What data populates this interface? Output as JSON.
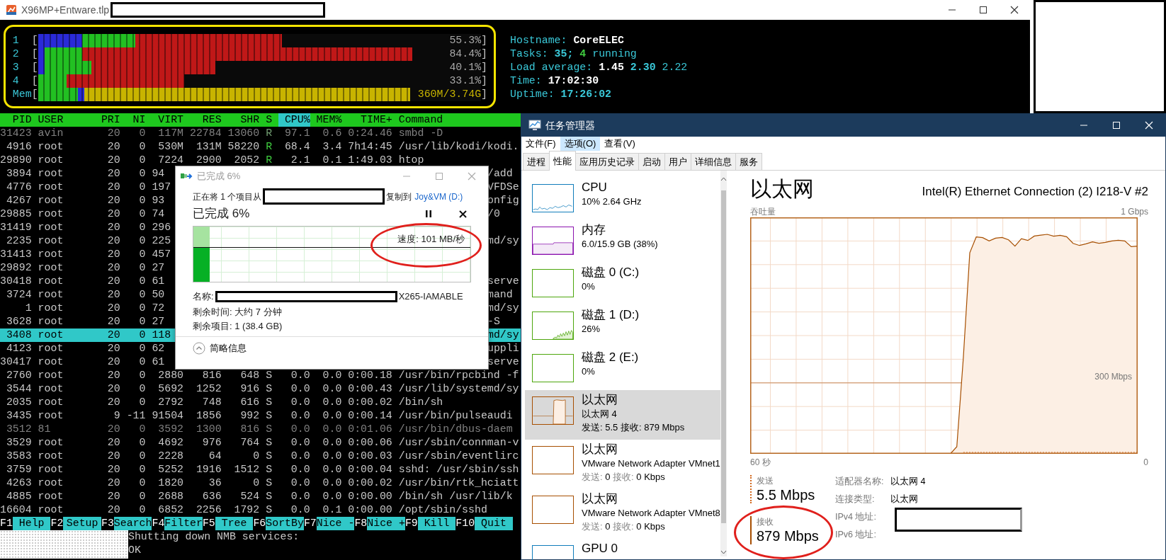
{
  "terminal": {
    "title": "X96MP+Entware.tlp",
    "meters": [
      {
        "kind": "cpu",
        "label": "1",
        "open": "[",
        "reading": "55.3%",
        "close": "]",
        "segments": [
          {
            "color": "#2a2ad8",
            "level": 0.1
          },
          {
            "color": "#22c022",
            "level": 0.22
          },
          {
            "color": "#c01818",
            "level": 0.55
          }
        ]
      },
      {
        "kind": "cpu",
        "label": "2",
        "open": "[",
        "reading": "84.4%",
        "close": "]",
        "segments": [
          {
            "color": "#2a2ad8",
            "level": 0.015
          },
          {
            "color": "#22c022",
            "level": 0.1
          },
          {
            "color": "#c01818",
            "level": 0.845
          }
        ]
      },
      {
        "kind": "cpu",
        "label": "3",
        "open": "[",
        "reading": "40.1%",
        "close": "]",
        "segments": [
          {
            "color": "#2a2ad8",
            "level": 0.015
          },
          {
            "color": "#22c022",
            "level": 0.12
          },
          {
            "color": "#c01818",
            "level": 0.4
          }
        ]
      },
      {
        "kind": "cpu",
        "label": "4",
        "open": "[",
        "reading": "33.1%",
        "close": "]",
        "segments": [
          {
            "color": "#22c022",
            "level": 0.065
          },
          {
            "color": "#c01818",
            "level": 0.33
          }
        ]
      },
      {
        "kind": "memory",
        "label": "Mem",
        "open": "[",
        "reading": "360M/3.74G",
        "close": "]",
        "segments": [
          {
            "color": "#22c022",
            "level": 0.09
          },
          {
            "color": "#2a2ad8",
            "level": 0.105
          },
          {
            "color": "#c8b400",
            "level": 0.84
          }
        ]
      }
    ],
    "info": [
      {
        "parts": [
          {
            "text": "Hostname:",
            "kind": "label"
          },
          {
            "text": "CoreELEC",
            "kind": "value"
          }
        ]
      },
      {
        "parts": [
          {
            "text": "Tasks:",
            "kind": "label"
          },
          {
            "text": "35;",
            "kind": "accent"
          },
          {
            "text": "4",
            "kind": "running"
          },
          {
            "text": "running",
            "kind": "label"
          }
        ]
      },
      {
        "parts": [
          {
            "text": "Load average:",
            "kind": "label"
          },
          {
            "text": "1.45",
            "kind": "value"
          },
          {
            "text": "2.30",
            "kind": "accent"
          },
          {
            "text": "2.22",
            "kind": "label"
          }
        ]
      },
      {
        "parts": [
          {
            "text": "Time:",
            "kind": "label"
          },
          {
            "text": "17:02:30",
            "kind": "value"
          }
        ]
      },
      {
        "parts": [
          {
            "text": "Uptime:",
            "kind": "label"
          },
          {
            "text": "17:26:02",
            "kind": "accent"
          }
        ]
      }
    ],
    "columns": [
      {
        "label": "PID",
        "selected": false
      },
      {
        "label": "USER",
        "selected": false
      },
      {
        "label": "PRI",
        "selected": false
      },
      {
        "label": "NI",
        "selected": false
      },
      {
        "label": "VIRT",
        "selected": false
      },
      {
        "label": "RES",
        "selected": false
      },
      {
        "label": "SHR",
        "selected": false
      },
      {
        "label": "S",
        "selected": false
      },
      {
        "label": "CPU%",
        "selected": true
      },
      {
        "label": "MEM%",
        "selected": false
      },
      {
        "label": "TIME+",
        "selected": false
      },
      {
        "label": "Command",
        "selected": false
      }
    ],
    "processes": [
      {
        "pid": "31423",
        "user": "avin",
        "pri": "20",
        "ni": "0",
        "virt": "117M",
        "res": "22784",
        "shr": "13060",
        "state": "R",
        "cpu": "97.1",
        "mem": "0.6",
        "time": "0:24.46",
        "command": "smbd -D",
        "running": true,
        "dimmed": true,
        "selected": false
      },
      {
        "pid": "4916",
        "user": "root",
        "pri": "20",
        "ni": "0",
        "virt": "530M",
        "res": "131M",
        "shr": "58220",
        "state": "R",
        "cpu": "68.4",
        "mem": "3.4",
        "time": "7h14:45",
        "command": "/usr/lib/kodi/kodi.",
        "running": true,
        "dimmed": false,
        "selected": false
      },
      {
        "pid": "29890",
        "user": "root",
        "pri": "20",
        "ni": "0",
        "virt": "7224",
        "res": "2900",
        "shr": "2052",
        "state": "R",
        "cpu": "2.1",
        "mem": "0.1",
        "time": "1:49.03",
        "command": "htop",
        "running": true,
        "dimmed": false,
        "selected": false
      },
      {
        "pid": "3894",
        "user": "root",
        "pri": "20",
        "ni": "0",
        "virt": "94",
        "command_tail": "/add",
        "dimmed": false,
        "selected": false
      },
      {
        "pid": "4776",
        "user": "root",
        "pri": "20",
        "ni": "0",
        "virt": "197",
        "command_tail": "VFDSe",
        "dimmed": false,
        "selected": false
      },
      {
        "pid": "4267",
        "user": "root",
        "pri": "20",
        "ni": "0",
        "virt": "93",
        "command_tail": "onfig",
        "dimmed": false,
        "selected": false
      },
      {
        "pid": "29885",
        "user": "root",
        "pri": "20",
        "ni": "0",
        "virt": "74",
        "command_tail": "/0",
        "dimmed": false,
        "selected": false
      },
      {
        "pid": "31419",
        "user": "root",
        "pri": "20",
        "ni": "0",
        "virt": "296",
        "dimmed": false,
        "selected": false
      },
      {
        "pid": "2235",
        "user": "root",
        "pri": "20",
        "ni": "0",
        "virt": "225",
        "command_tail": "md/sy",
        "dimmed": false,
        "selected": false
      },
      {
        "pid": "31413",
        "user": "root",
        "pri": "20",
        "ni": "0",
        "virt": "457",
        "dimmed": false,
        "selected": false
      },
      {
        "pid": "29892",
        "user": "root",
        "pri": "20",
        "ni": "0",
        "virt": "27",
        "dimmed": false,
        "selected": false
      },
      {
        "pid": "30418",
        "user": "root",
        "pri": "20",
        "ni": "0",
        "virt": "61",
        "command_tail": "serve",
        "dimmed": false,
        "selected": false
      },
      {
        "pid": "3724",
        "user": "root",
        "pri": "20",
        "ni": "0",
        "virt": "50",
        "command_tail": "mand",
        "dimmed": false,
        "selected": false
      },
      {
        "pid": "1",
        "user": "root",
        "pri": "20",
        "ni": "0",
        "virt": "72",
        "command_tail": "md/sy",
        "dimmed": false,
        "selected": false
      },
      {
        "pid": "3628",
        "user": "root",
        "pri": "20",
        "ni": "0",
        "virt": "27",
        "command_tail": "-S",
        "dimmed": false,
        "selected": false
      },
      {
        "pid": "3408",
        "user": "root",
        "pri": "20",
        "ni": "0",
        "virt": "118",
        "command_tail": "md/sy",
        "dimmed": false,
        "selected": true
      },
      {
        "pid": "4123",
        "user": "root",
        "pri": "20",
        "ni": "0",
        "virt": "62",
        "command_tail": "uppli",
        "dimmed": false,
        "selected": false
      },
      {
        "pid": "30417",
        "user": "root",
        "pri": "20",
        "ni": "0",
        "virt": "61",
        "command_tail": "serve",
        "dimmed": false,
        "selected": false
      },
      {
        "pid": "2760",
        "user": "root",
        "pri": "20",
        "ni": "0",
        "virt": "2880",
        "res": "816",
        "shr": "648",
        "state": "S",
        "cpu": "0.0",
        "mem": "0.0",
        "time": "0:00.18",
        "command": "/usr/bin/rpcbind -f",
        "running": false,
        "dimmed": false,
        "selected": false
      },
      {
        "pid": "3544",
        "user": "root",
        "pri": "20",
        "ni": "0",
        "virt": "5692",
        "res": "1252",
        "shr": "916",
        "state": "S",
        "cpu": "0.0",
        "mem": "0.0",
        "time": "0:00.43",
        "command": "/usr/lib/systemd/sy",
        "running": false,
        "dimmed": false,
        "selected": false
      },
      {
        "pid": "2035",
        "user": "root",
        "pri": "20",
        "ni": "0",
        "virt": "2792",
        "res": "748",
        "shr": "616",
        "state": "S",
        "cpu": "0.0",
        "mem": "0.0",
        "time": "0:00.02",
        "command": "/bin/sh",
        "running": false,
        "dimmed": false,
        "selected": false
      },
      {
        "pid": "3435",
        "user": "root",
        "pri": "9",
        "ni": "-11",
        "virt": "91504",
        "res": "1856",
        "shr": "992",
        "state": "S",
        "cpu": "0.0",
        "mem": "0.0",
        "time": "0:00.14",
        "command": "/usr/bin/pulseaudi",
        "running": false,
        "dimmed": false,
        "selected": false
      },
      {
        "pid": "3512",
        "user": "81",
        "pri": "20",
        "ni": "0",
        "virt": "3592",
        "res": "1300",
        "shr": "816",
        "state": "S",
        "cpu": "0.0",
        "mem": "0.0",
        "time": "0:01.06",
        "command": "/usr/bin/dbus-daem",
        "running": false,
        "dimmed": true,
        "selected": false
      },
      {
        "pid": "3529",
        "user": "root",
        "pri": "20",
        "ni": "0",
        "virt": "4692",
        "res": "976",
        "shr": "764",
        "state": "S",
        "cpu": "0.0",
        "mem": "0.0",
        "time": "0:00.06",
        "command": "/usr/sbin/connman-v",
        "running": false,
        "dimmed": false,
        "selected": false
      },
      {
        "pid": "3583",
        "user": "root",
        "pri": "20",
        "ni": "0",
        "virt": "2228",
        "res": "64",
        "shr": "0",
        "state": "S",
        "cpu": "0.0",
        "mem": "0.0",
        "time": "0:00.03",
        "command": "/usr/sbin/eventlirc",
        "running": false,
        "dimmed": false,
        "selected": false
      },
      {
        "pid": "3759",
        "user": "root",
        "pri": "20",
        "ni": "0",
        "virt": "5252",
        "res": "1916",
        "shr": "1512",
        "state": "S",
        "cpu": "0.0",
        "mem": "0.0",
        "time": "0:00.04",
        "command": "sshd: /usr/sbin/ssh",
        "running": false,
        "dimmed": false,
        "selected": false
      },
      {
        "pid": "4263",
        "user": "root",
        "pri": "20",
        "ni": "0",
        "virt": "1820",
        "res": "36",
        "shr": "0",
        "state": "S",
        "cpu": "0.0",
        "mem": "0.0",
        "time": "0:00.02",
        "command": "/usr/bin/rtk_hciatt",
        "running": false,
        "dimmed": false,
        "selected": false
      },
      {
        "pid": "4885",
        "user": "root",
        "pri": "20",
        "ni": "0",
        "virt": "2688",
        "res": "636",
        "shr": "524",
        "state": "S",
        "cpu": "0.0",
        "mem": "0.0",
        "time": "0:00.00",
        "command": "/bin/sh /usr/lib/k",
        "running": false,
        "dimmed": false,
        "selected": false
      },
      {
        "pid": "16604",
        "user": "root",
        "pri": "20",
        "ni": "0",
        "virt": "6852",
        "res": "2256",
        "shr": "1792",
        "state": "S",
        "cpu": "0.0",
        "mem": "0.1",
        "time": "0:00.00",
        "command": "/opt/sbin/sshd",
        "running": false,
        "dimmed": false,
        "selected": false
      }
    ],
    "function_keys": [
      {
        "key": "F1",
        "label": "Help"
      },
      {
        "key": "F2",
        "label": "Setup"
      },
      {
        "key": "F3",
        "label": "Search"
      },
      {
        "key": "F4",
        "label": "Filter"
      },
      {
        "key": "F5",
        "label": "Tree"
      },
      {
        "key": "F6",
        "label": "SortBy"
      },
      {
        "key": "F7",
        "label": "Nice -"
      },
      {
        "key": "F8",
        "label": "Nice +"
      },
      {
        "key": "F9",
        "label": "Kill"
      },
      {
        "key": "F10",
        "label": "Quit"
      }
    ],
    "output_lines": [
      "Shutting down NMB services:",
      "OK"
    ]
  },
  "copy_dialog": {
    "title": "已完成 6%",
    "source_text": "正在将 1 个项目从",
    "dest_text": "复制到",
    "dest_link": "Joy&VM (D:)",
    "heading": "已完成 6%",
    "speed": "速度: 101 MB/秒",
    "progress": {
      "level": 0.06
    },
    "name_label": "名称:",
    "name_suffix": "X265-IAMABLE",
    "time_left": "剩余时间: 大约 7 分钟",
    "items_left": "剩余项目: 1 (38.4 GB)",
    "details_toggle": "简略信息"
  },
  "task_manager": {
    "title": "任务管理器",
    "menu": [
      {
        "label": "文件(F)",
        "hovered": false
      },
      {
        "label": "选项(O)",
        "hovered": true
      },
      {
        "label": "查看(V)",
        "hovered": false
      }
    ],
    "tabs": [
      {
        "label": "进程",
        "selected": false
      },
      {
        "label": "性能",
        "selected": true
      },
      {
        "label": "应用历史记录",
        "selected": false
      },
      {
        "label": "启动",
        "selected": false
      },
      {
        "label": "用户",
        "selected": false
      },
      {
        "label": "详细信息",
        "selected": false
      },
      {
        "label": "服务",
        "selected": false
      }
    ],
    "resources": [
      {
        "kind": "cpu",
        "title": "CPU",
        "subtitle": "10% 2.64 GHz",
        "color": "#117dbb",
        "selected": false
      },
      {
        "kind": "memory",
        "title": "内存",
        "subtitle": "6.0/15.9 GB (38%)",
        "color": "#8b12ae",
        "selected": false
      },
      {
        "kind": "idle",
        "title": "磁盘 0 (C:)",
        "subtitle": "0%",
        "color": "#4da60c",
        "selected": false
      },
      {
        "kind": "disk-active",
        "title": "磁盘 1 (D:)",
        "subtitle": "26%",
        "color": "#4da60c",
        "selected": false
      },
      {
        "kind": "idle",
        "title": "磁盘 2 (E:)",
        "subtitle": "0%",
        "color": "#4da60c",
        "selected": false
      },
      {
        "kind": "network-active",
        "title": "以太网",
        "subtitle": "以太网 4",
        "stats": [
          {
            "label": "发送:",
            "value": "5.5"
          },
          {
            "label": "接收:",
            "value": "879 Mbps"
          }
        ],
        "color": "#a74f01",
        "selected": true
      },
      {
        "kind": "idle",
        "title": "以太网",
        "subtitle": "VMware Network Adapter VMnet1",
        "stats": [
          {
            "label": "发送:",
            "value": "0"
          },
          {
            "label": "接收:",
            "value": "0 Kbps"
          }
        ],
        "color": "#a74f01",
        "selected": false
      },
      {
        "kind": "idle",
        "title": "以太网",
        "subtitle": "VMware Network Adapter VMnet8",
        "stats": [
          {
            "label": "发送:",
            "value": "0"
          },
          {
            "label": "接收:",
            "value": "0 Kbps"
          }
        ],
        "color": "#a74f01",
        "selected": false
      },
      {
        "kind": "idle",
        "title": "GPU 0",
        "color": "#117dbb",
        "selected": false
      }
    ],
    "detail": {
      "title": "以太网",
      "device": "Intel(R) Ethernet Connection (2) I218-V #2",
      "chart": {
        "ylabel": "吞吐量",
        "max_label": "1 Gbps",
        "scale_label": "300 Mbps",
        "start_label": "60 秒",
        "end_label": "0"
      },
      "send": {
        "label": "发送",
        "value": "5.5 Mbps"
      },
      "receive": {
        "label": "接收",
        "value": "879 Mbps"
      },
      "properties": [
        {
          "label": "适配器名称:",
          "value": "以太网 4"
        },
        {
          "label": "连接类型:",
          "value": "以太网"
        },
        {
          "label": "IPv4 地址:"
        },
        {
          "label": "IPv6 地址:"
        }
      ]
    }
  }
}
